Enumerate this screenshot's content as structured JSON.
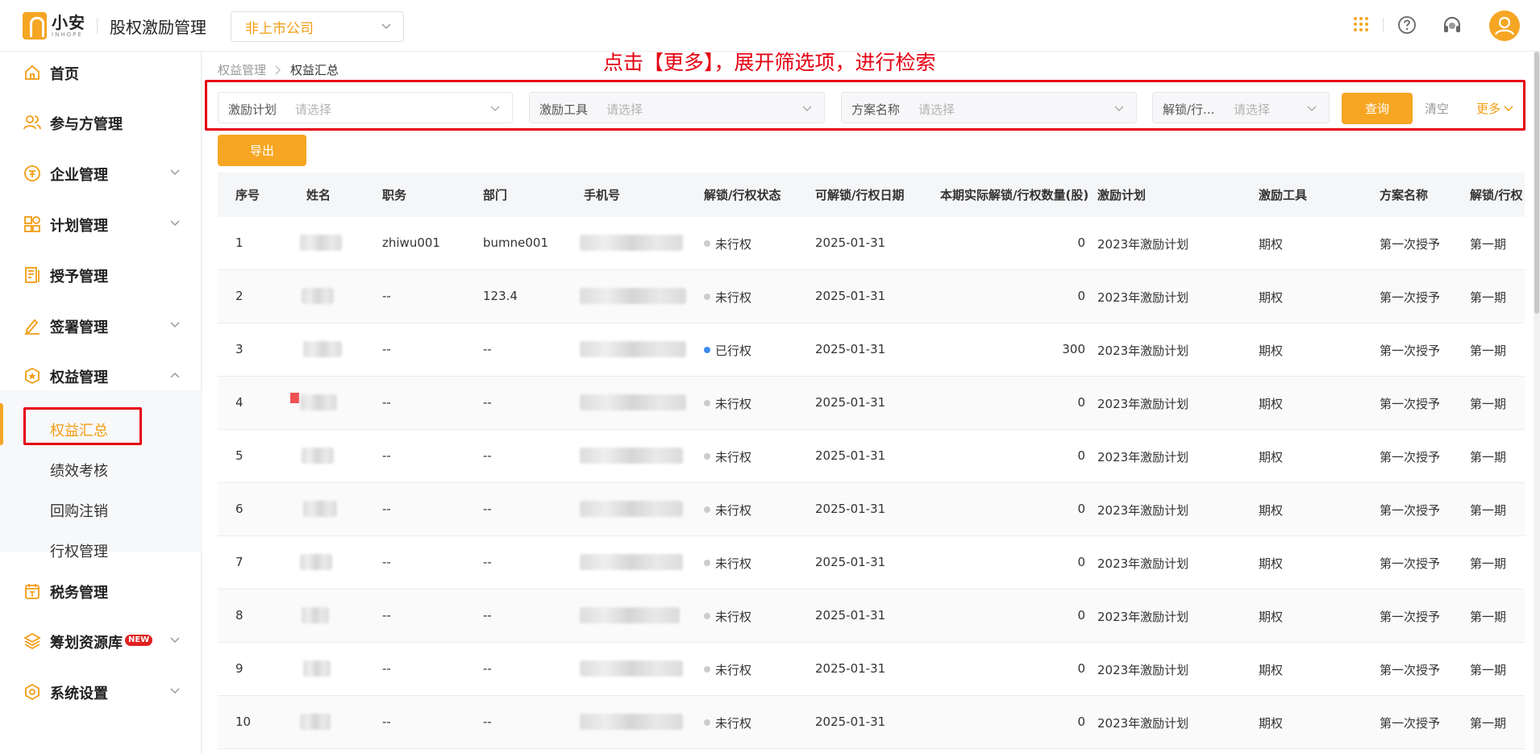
{
  "header": {
    "logo_name": "小安",
    "logo_sub": "INHOPE",
    "app_title": "股权激励管理",
    "company_select": "非上市公司",
    "icons": [
      "apps-grid-icon",
      "help-icon",
      "support-headset-icon",
      "user-avatar-icon"
    ]
  },
  "sidebar": {
    "items": [
      {
        "label": "首页",
        "icon": "home-icon"
      },
      {
        "label": "参与方管理",
        "icon": "users-icon"
      },
      {
        "label": "企业管理",
        "icon": "enterprise-icon"
      },
      {
        "label": "计划管理",
        "icon": "plan-icon"
      },
      {
        "label": "授予管理",
        "icon": "grant-icon"
      },
      {
        "label": "签署管理",
        "icon": "sign-icon"
      },
      {
        "label": "权益管理",
        "icon": "equity-icon"
      },
      {
        "label": "税务管理",
        "icon": "tax-icon"
      },
      {
        "label": "筹划资源库",
        "icon": "resource-layers-icon",
        "badge": "NEW"
      },
      {
        "label": "系统设置",
        "icon": "settings-icon"
      }
    ],
    "sub_items": [
      "权益汇总",
      "绩效考核",
      "回购注销",
      "行权管理"
    ],
    "active_sub": "权益汇总"
  },
  "main": {
    "breadcrumb": [
      "权益管理",
      "权益汇总"
    ],
    "annotation": "点击【更多】，展开筛选项，进行检索",
    "filters": [
      {
        "label": "激励计划",
        "placeholder": "请选择"
      },
      {
        "label": "激励工具",
        "placeholder": "请选择"
      },
      {
        "label": "方案名称",
        "placeholder": "请选择"
      },
      {
        "label": "解锁/行...",
        "placeholder": "请选择"
      }
    ],
    "query_label": "查询",
    "clear_label": "清空",
    "more_label": "更多",
    "export_label": "导出"
  },
  "table": {
    "columns": [
      "序号",
      "姓名",
      "职务",
      "部门",
      "手机号",
      "解锁/行权状态",
      "可解锁/行权日期",
      "本期实际解锁/行权数量(股)",
      "激励计划",
      "激励工具",
      "方案名称",
      "解锁/行权"
    ],
    "rows": [
      {
        "no": "1",
        "title": "zhiwu001",
        "dept": "bumne001",
        "status": "未行权",
        "date": "2025-01-31",
        "qty": "0",
        "plan": "2023年激励计划",
        "tool": "期权",
        "scheme": "第一次授予",
        "period": "第一期"
      },
      {
        "no": "2",
        "title": "--",
        "dept": "123.4",
        "status": "未行权",
        "date": "2025-01-31",
        "qty": "0",
        "plan": "2023年激励计划",
        "tool": "期权",
        "scheme": "第一次授予",
        "period": "第一期"
      },
      {
        "no": "3",
        "title": "--",
        "dept": "--",
        "status": "已行权",
        "date": "2025-01-31",
        "qty": "300",
        "plan": "2023年激励计划",
        "tool": "期权",
        "scheme": "第一次授予",
        "period": "第一期"
      },
      {
        "no": "4",
        "title": "--",
        "dept": "--",
        "status": "未行权",
        "date": "2025-01-31",
        "qty": "0",
        "plan": "2023年激励计划",
        "tool": "期权",
        "scheme": "第一次授予",
        "period": "第一期"
      },
      {
        "no": "5",
        "title": "--",
        "dept": "--",
        "status": "未行权",
        "date": "2025-01-31",
        "qty": "0",
        "plan": "2023年激励计划",
        "tool": "期权",
        "scheme": "第一次授予",
        "period": "第一期"
      },
      {
        "no": "6",
        "title": "--",
        "dept": "--",
        "status": "未行权",
        "date": "2025-01-31",
        "qty": "0",
        "plan": "2023年激励计划",
        "tool": "期权",
        "scheme": "第一次授予",
        "period": "第一期"
      },
      {
        "no": "7",
        "title": "--",
        "dept": "--",
        "status": "未行权",
        "date": "2025-01-31",
        "qty": "0",
        "plan": "2023年激励计划",
        "tool": "期权",
        "scheme": "第一次授予",
        "period": "第一期"
      },
      {
        "no": "8",
        "title": "--",
        "dept": "--",
        "status": "未行权",
        "date": "2025-01-31",
        "qty": "0",
        "plan": "2023年激励计划",
        "tool": "期权",
        "scheme": "第一次授予",
        "period": "第一期"
      },
      {
        "no": "9",
        "title": "--",
        "dept": "--",
        "status": "未行权",
        "date": "2025-01-31",
        "qty": "0",
        "plan": "2023年激励计划",
        "tool": "期权",
        "scheme": "第一次授予",
        "period": "第一期"
      },
      {
        "no": "10",
        "title": "--",
        "dept": "--",
        "status": "未行权",
        "date": "2025-01-31",
        "qty": "0",
        "plan": "2023年激励计划",
        "tool": "期权",
        "scheme": "第一次授予",
        "period": "第一期"
      }
    ]
  },
  "colors": {
    "accent": "#f6a623",
    "annotation_red": "#e60012",
    "status_done": "#3d8bf0",
    "status_pending": "#cccccc"
  }
}
